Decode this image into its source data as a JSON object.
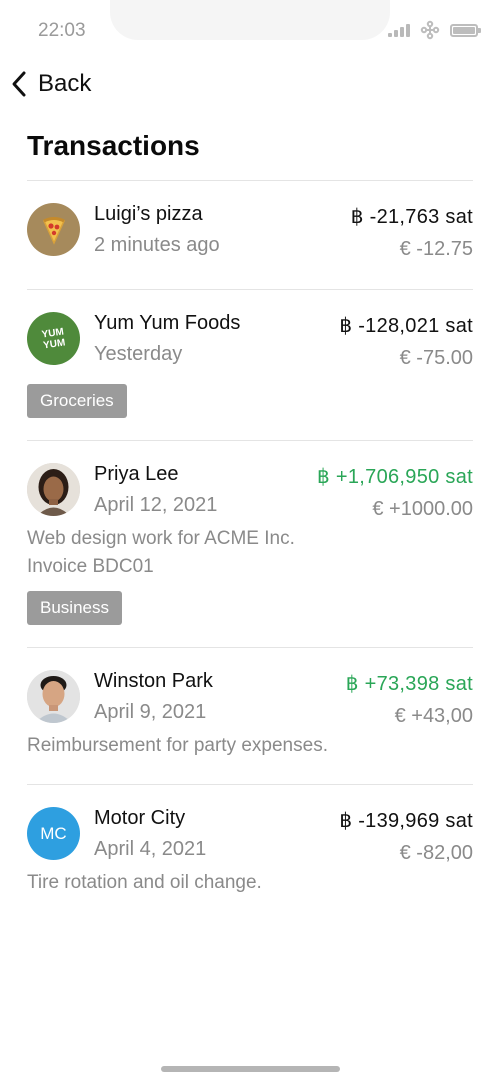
{
  "status_bar": {
    "time": "22:03"
  },
  "nav": {
    "back_label": "Back"
  },
  "page": {
    "title": "Transactions"
  },
  "colors": {
    "positive": "#2aa657",
    "tag_bg": "#9b9b9b",
    "muted": "#8a8a8a",
    "avatar_blue": "#2e9fe0",
    "avatar_green": "#4f8a3b",
    "avatar_pizza": "#a68a5c"
  },
  "transactions": [
    {
      "name": "Luigi’s pizza",
      "date": "2 minutes ago",
      "amount": "฿ -21,763 sat",
      "fiat": "€ -12.75",
      "avatar_icon": "pizza-icon"
    },
    {
      "name": "Yum Yum Foods",
      "date": "Yesterday",
      "amount": "฿ -128,021 sat",
      "fiat": "€ -75.00",
      "tag": "Groceries",
      "avatar_text_1": "YUM",
      "avatar_text_2": "YUM"
    },
    {
      "name": "Priya Lee",
      "date": "April 12, 2021",
      "amount": "฿ +1,706,950 sat",
      "fiat": "€ +1000.00",
      "desc_1": "Web design work for ACME Inc.",
      "desc_2": "Invoice BDC01",
      "tag": "Business",
      "avatar_icon": "person-photo"
    },
    {
      "name": "Winston Park",
      "date": "April 9, 2021",
      "amount": "฿ +73,398 sat",
      "fiat": "€ +43,00",
      "desc_1": "Reimbursement for party expenses.",
      "avatar_icon": "person-photo"
    },
    {
      "name": "Motor City",
      "date": "April 4, 2021",
      "amount": "฿ -139,969 sat",
      "fiat": "€ -82,00",
      "desc_1": "Tire rotation and oil change.",
      "avatar_initials": "MC"
    }
  ]
}
